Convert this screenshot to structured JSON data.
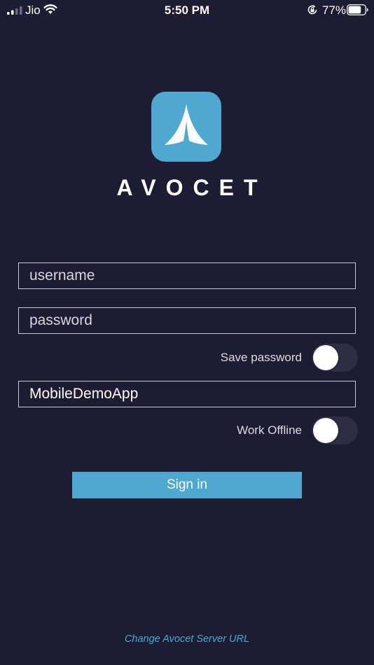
{
  "status_bar": {
    "carrier": "Jio",
    "time": "5:50 PM",
    "battery_percent": "77%",
    "signal_bars": 2,
    "battery_level": 0.77,
    "icons": [
      "signal-icon",
      "wifi-icon",
      "rotation-lock-icon",
      "battery-icon"
    ]
  },
  "branding": {
    "app_name": "AVOCET",
    "logo_icon": "avocet-logo-icon"
  },
  "form": {
    "username_placeholder": "username",
    "username_value": "",
    "password_placeholder": "password",
    "password_value": "",
    "save_password_label": "Save password",
    "save_password_on": false,
    "server_value": "MobileDemoApp",
    "work_offline_label": "Work Offline",
    "work_offline_on": false,
    "sign_in_label": "Sign in"
  },
  "footer": {
    "change_server_label": "Change Avocet Server URL"
  },
  "colors": {
    "background": "#1e1c33",
    "accent": "#4ea8cf",
    "toggle_off": "#2e2d44"
  }
}
